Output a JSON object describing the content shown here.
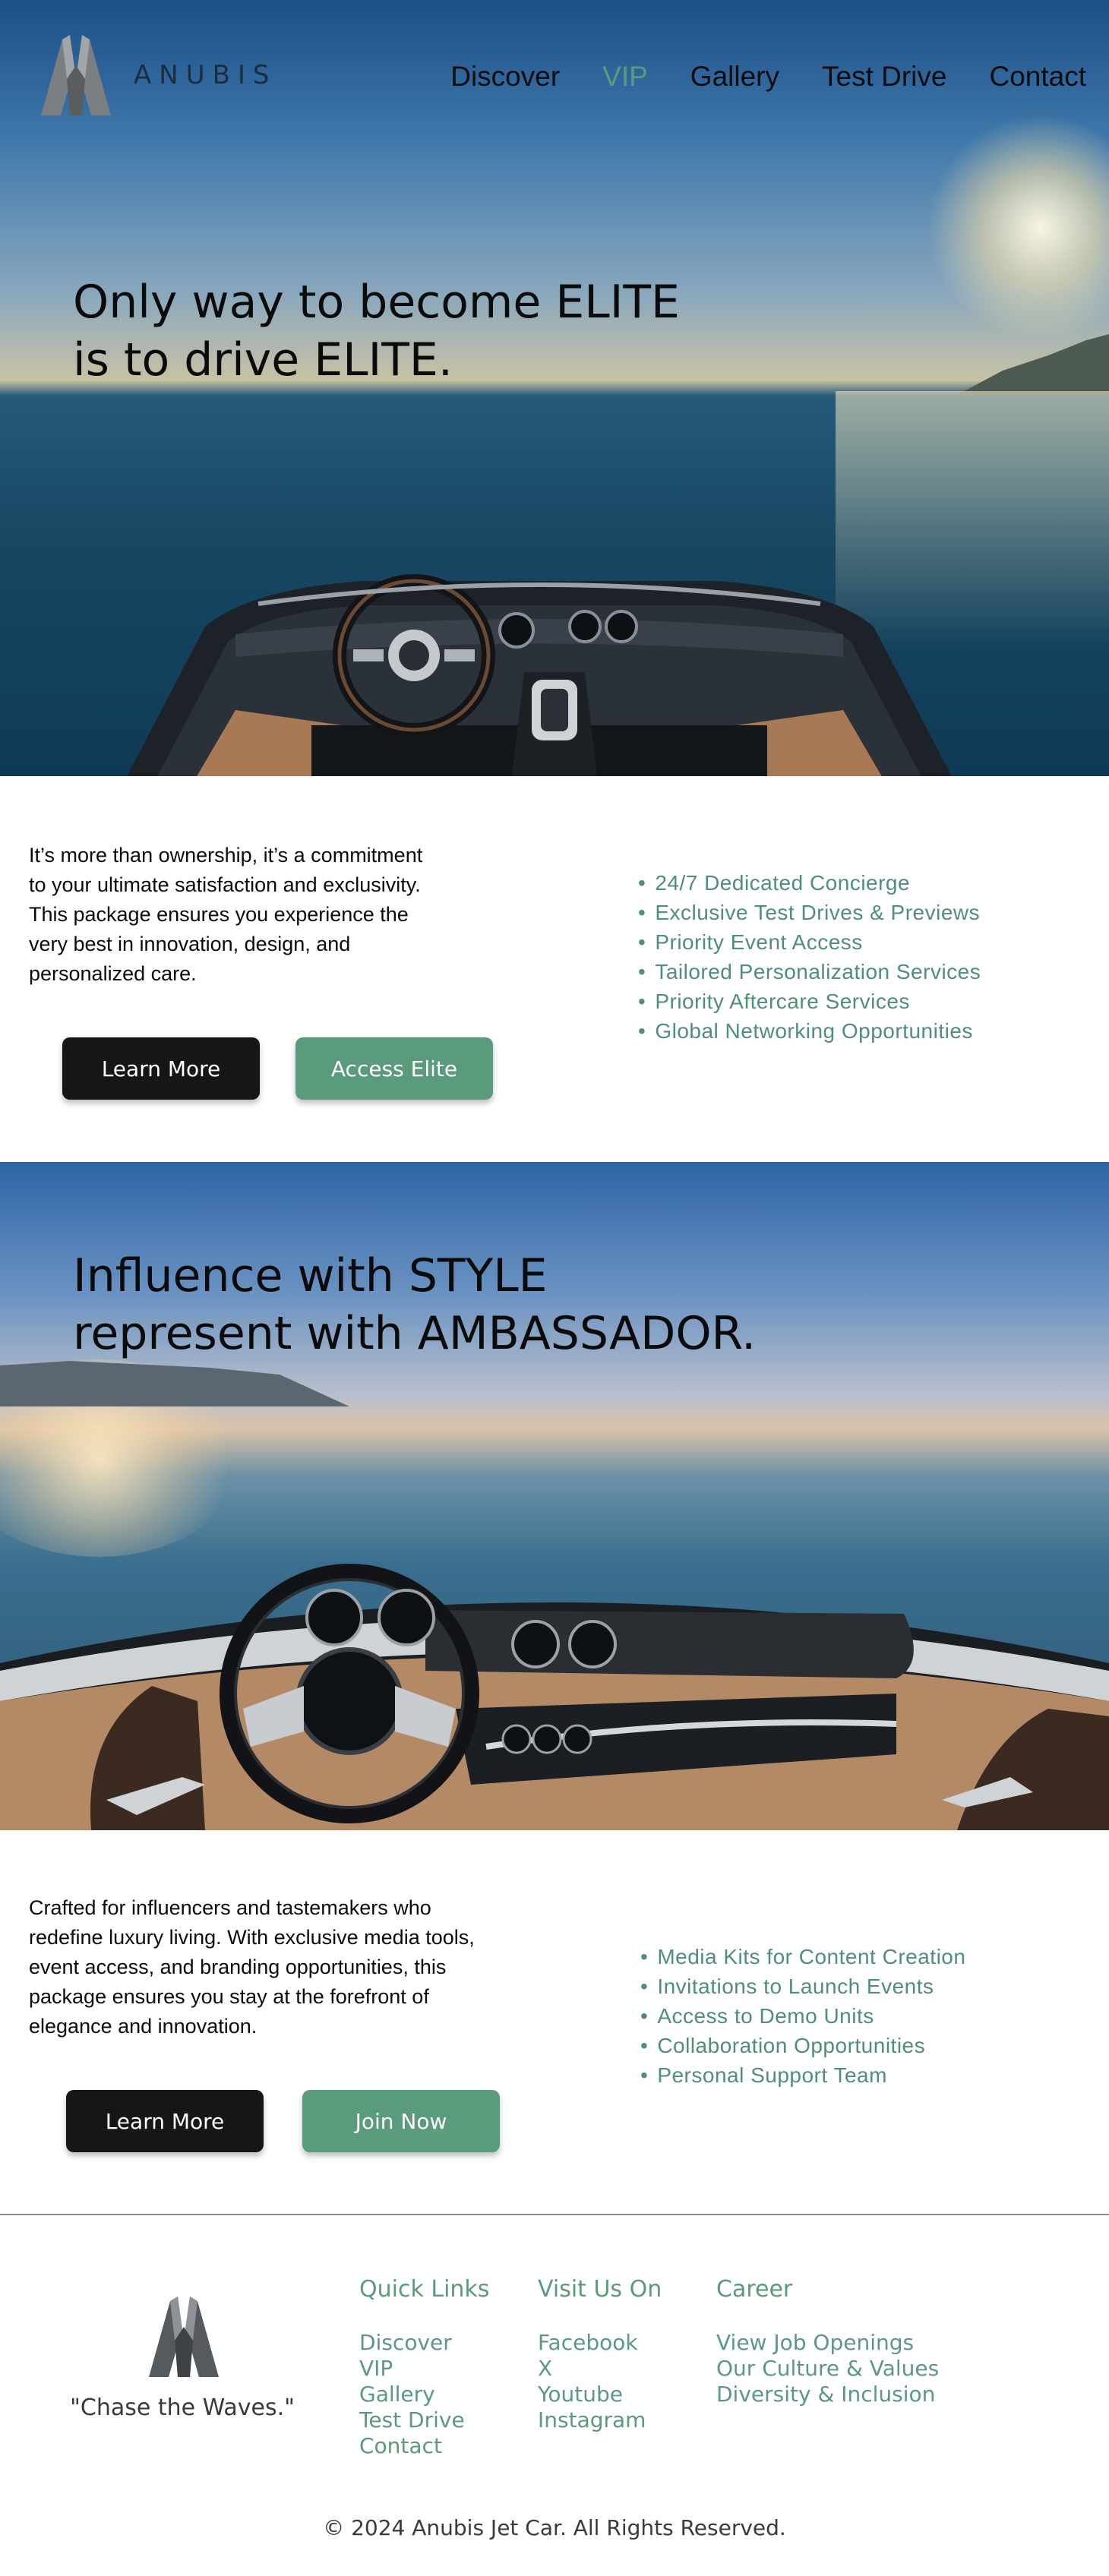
{
  "brand": {
    "name": "ANUBIS"
  },
  "nav": {
    "items": [
      {
        "label": "Discover"
      },
      {
        "label": "VIP"
      },
      {
        "label": "Gallery"
      },
      {
        "label": "Test Drive"
      },
      {
        "label": "Contact"
      }
    ],
    "active": "VIP"
  },
  "hero1": {
    "line1": "Only way to become ELITE",
    "line2": "is to drive ELITE."
  },
  "elite": {
    "description": [
      "It’s more than ownership, it’s a commitment",
      "to your ultimate satisfaction and exclusivity.",
      "This package ensures you experience the",
      "very best in innovation, design, and",
      "personalized care."
    ],
    "benefits": [
      "24/7 Dedicated  Concierge",
      "Exclusive Test Drives & Previews",
      "Priority Event Access",
      "Tailored Personalization Services",
      "Priority Aftercare Services",
      "Global Networking Opportunities"
    ],
    "learn_more_label": "Learn More",
    "cta_label": "Access Elite"
  },
  "hero2": {
    "line1": "Influence with STYLE",
    "line2": "represent with AMBASSADOR."
  },
  "ambassador": {
    "description": [
      "Crafted for influencers and tastemakers who",
      "redefine luxury living. With exclusive media tools,",
      "event access, and branding opportunities, this",
      "package ensures you stay at the forefront of",
      "elegance and innovation."
    ],
    "benefits": [
      "Media Kits for Content Creation",
      "Invitations to Launch Events",
      "Access to Demo Units",
      "Collaboration Opportunities",
      "Personal Support Team"
    ],
    "learn_more_label": "Learn More",
    "cta_label": "Join Now"
  },
  "footer": {
    "tagline": "\"Chase the Waves.\"",
    "columns": [
      {
        "title": "Quick Links",
        "links": [
          "Discover",
          "VIP",
          "Gallery",
          "Test Drive",
          "Contact"
        ]
      },
      {
        "title": "Visit Us On",
        "links": [
          "Facebook",
          "X",
          "Youtube",
          "Instagram"
        ]
      },
      {
        "title": "Career",
        "links": [
          "View Job Openings",
          "Our Culture & Values",
          "Diversity & Inclusion"
        ]
      }
    ],
    "copyright": "© 2024 Anubis Jet Car. All Rights Reserved."
  },
  "colors": {
    "accent": "#5a9a7d",
    "dark_button": "#161616",
    "text": "#0b0b0b"
  },
  "icons": {
    "logo": "anubis-logo-icon"
  }
}
